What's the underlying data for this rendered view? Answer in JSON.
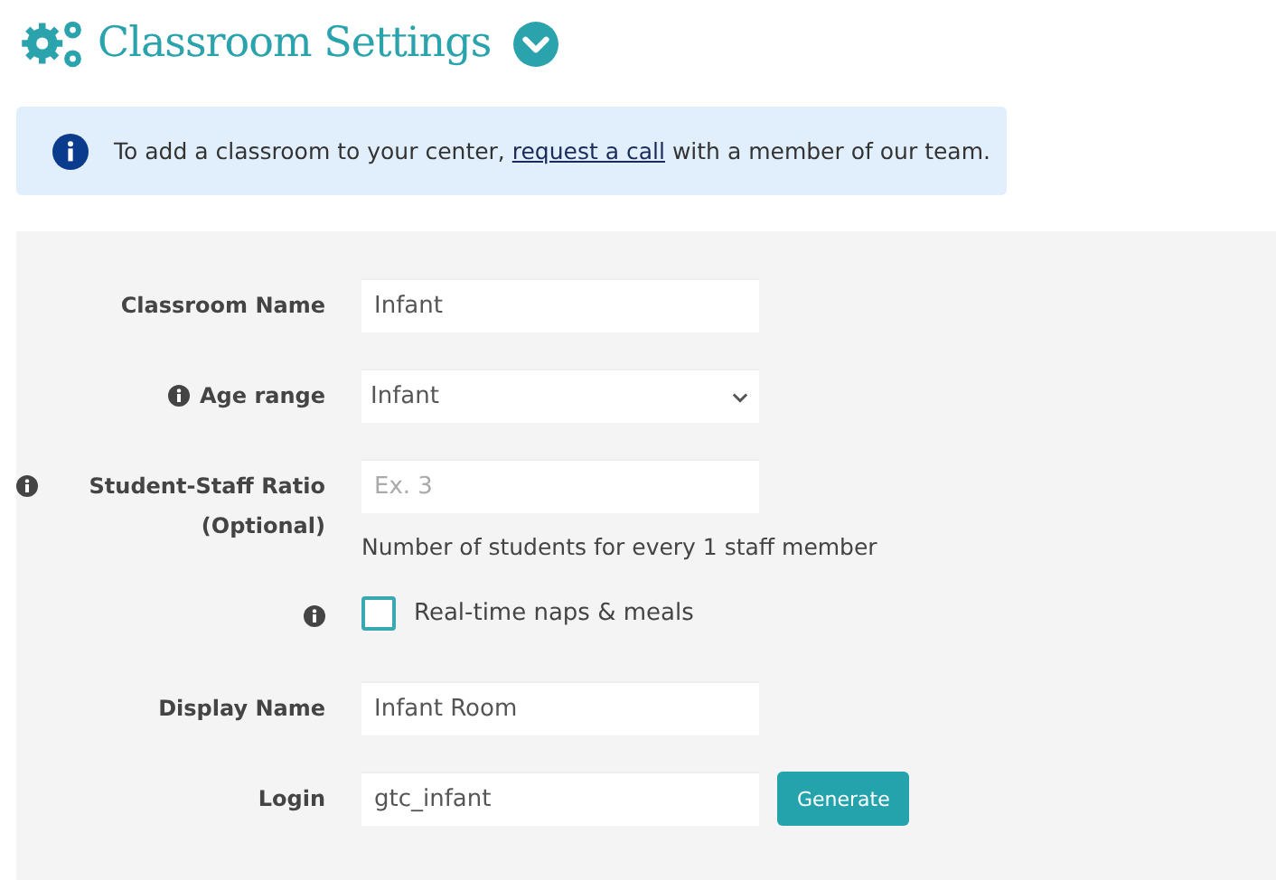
{
  "header": {
    "title": "Classroom Settings"
  },
  "notice": {
    "before": "To add a classroom to your center, ",
    "link": "request a call",
    "after": " with a member of our team."
  },
  "fields": [
    {
      "kind": "text",
      "label": "Classroom Name",
      "info": false,
      "value": "Infant"
    },
    {
      "kind": "select",
      "label": "Age range",
      "info": true,
      "value": "Infant"
    },
    {
      "kind": "text",
      "label": "Student-Staff Ratio (Optional)",
      "info": true,
      "placeholder": "Ex. 3",
      "help": "Number of students for every 1 staff member"
    },
    {
      "kind": "checkbox",
      "info": true,
      "label": "Real-time naps & meals",
      "checked": false
    },
    {
      "kind": "text",
      "label": "Display Name",
      "info": false,
      "value": "Infant Room"
    },
    {
      "kind": "text",
      "label": "Login",
      "info": false,
      "value": "gtc_infant",
      "button": "Generate"
    }
  ]
}
